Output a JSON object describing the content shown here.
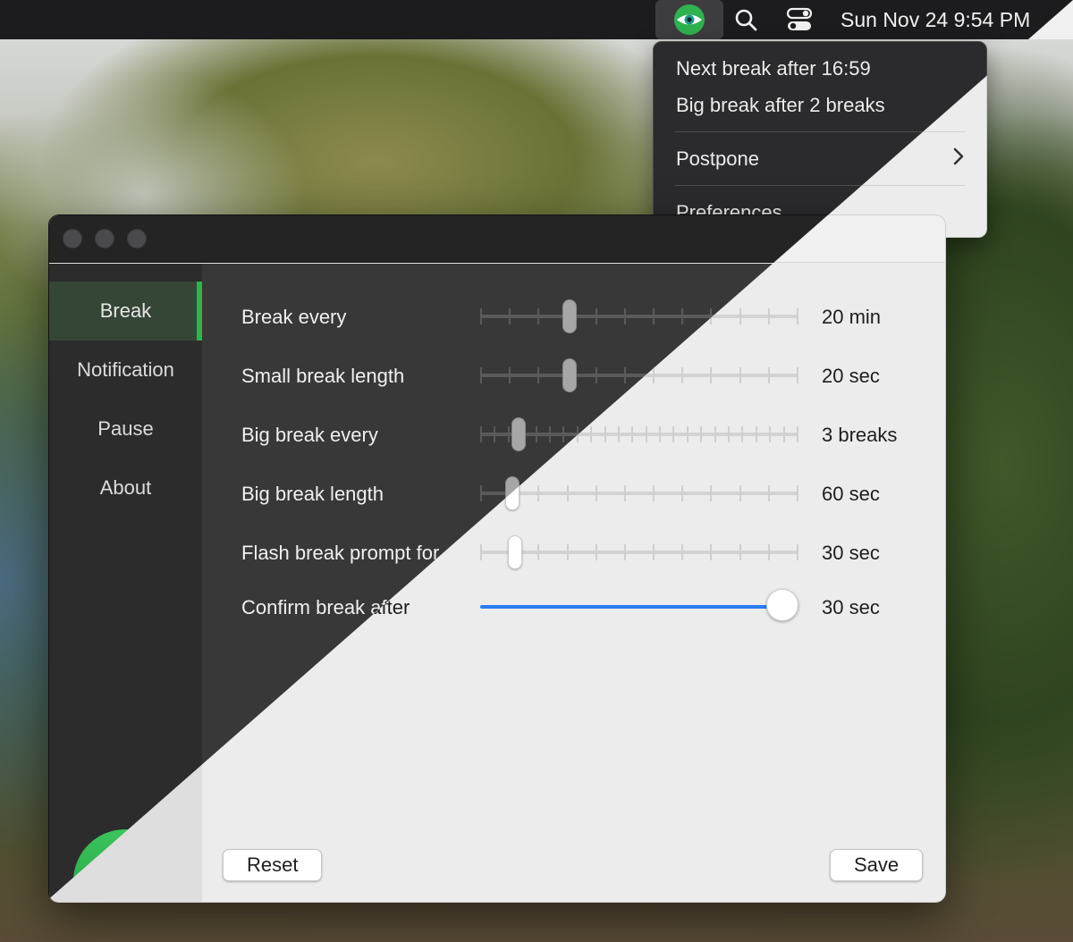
{
  "menubar": {
    "app_icon": "eye-icon",
    "search_icon": "search-icon",
    "control_center_icon": "toggle-switches-icon",
    "clock": "Sun Nov 24  9:54 PM"
  },
  "menu": {
    "next_break": "Next break after 16:59",
    "big_break": "Big break after 2 breaks",
    "postpone": "Postpone",
    "preferences": "Preferences"
  },
  "sidebar": {
    "items": [
      {
        "label": "Break",
        "active": true
      },
      {
        "label": "Notification",
        "active": false
      },
      {
        "label": "Pause",
        "active": false
      },
      {
        "label": "About",
        "active": false
      }
    ],
    "logo": "eye-logo"
  },
  "settings": [
    {
      "label": "Break every",
      "value": "20 min",
      "ticks": 12,
      "position": 0.28
    },
    {
      "label": "Small break length",
      "value": "20 sec",
      "ticks": 12,
      "position": 0.28
    },
    {
      "label": "Big break every",
      "value": "3 breaks",
      "ticks": 24,
      "position": 0.12
    },
    {
      "label": "Big break length",
      "value": "60 sec",
      "ticks": 12,
      "position": 0.1
    },
    {
      "label": "Flash break prompt for",
      "value": "30 sec",
      "ticks": 12,
      "position": 0.11
    },
    {
      "label": "Confirm break after",
      "value": "30 sec",
      "ticks": 0,
      "position": 0.95
    }
  ],
  "buttons": {
    "reset": "Reset",
    "save": "Save"
  },
  "colors": {
    "accent_green": "#2fb24f",
    "slider_blue": "#2a7cf0",
    "dark_bg": "#383838",
    "light_bg": "#ececec"
  }
}
